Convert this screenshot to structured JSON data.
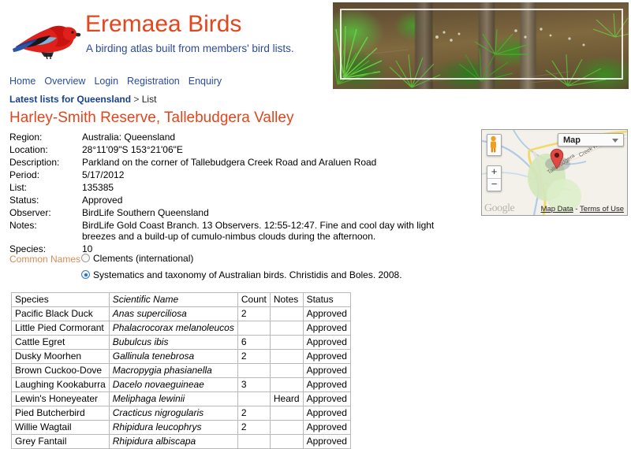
{
  "site": {
    "title": "Eremaea Birds",
    "tagline": "A birding atlas built from members' bird lists.",
    "logo_alt": "crimson-rosella-logo",
    "banner_alt": "rainforest-palm-understorey-photo"
  },
  "nav": {
    "items": [
      {
        "label": "Home"
      },
      {
        "label": "Overview"
      },
      {
        "label": "Login"
      },
      {
        "label": "Registration"
      },
      {
        "label": "Enquiry"
      }
    ]
  },
  "breadcrumb": {
    "parent": "Latest lists for Queensland",
    "separator": ">",
    "current": "List"
  },
  "page": {
    "title": "Harley-Smith Reserve, Tallebudgera Valley"
  },
  "details": {
    "rows": [
      {
        "key": "Region:",
        "value": "Australia: Queensland"
      },
      {
        "key": "Location:",
        "value": "28°11'09\"S 153°21'06\"E"
      },
      {
        "key": "Description:",
        "value": "Parkland on the corner of Tallebudgera Creek Road and Araluen Road"
      },
      {
        "key": "Period:",
        "value": "5/17/2012"
      },
      {
        "key": "List:",
        "value": "135385"
      },
      {
        "key": "Status:",
        "value": "Approved"
      },
      {
        "key": "Observer:",
        "value": "BirdLife Southern Queensland"
      },
      {
        "key": "Notes:",
        "value": "BirdLife Gold Coast Branch. 13 Observers. 12:55-12:47. Fine and cool day with light breezes and a build-up of cumulo-nimbus clouds during the afternoon."
      },
      {
        "key": "Species:",
        "value": "10"
      }
    ]
  },
  "map": {
    "type_button": "Map",
    "zoom_in": "+",
    "zoom_out": "−",
    "road_label": "Tallebudgera",
    "road_label2": "Creek Rd",
    "watermark": "Google",
    "map_data_link": "Map Data",
    "attrib_separator": "-",
    "terms_link": "Terms of Use"
  },
  "common_names": {
    "label": "Common Names",
    "options": [
      {
        "label": "Clements (international)",
        "selected": false
      },
      {
        "label": "Systematics and taxonomy of Australian birds. Christidis and Boles. 2008.",
        "selected": true
      }
    ]
  },
  "species_table": {
    "columns": [
      "Species",
      "Scientific Name",
      "Count",
      "Notes",
      "Status"
    ],
    "rows": [
      {
        "species": "Pacific Black Duck",
        "scientific": "Anas superciliosa",
        "count": "2",
        "notes": "",
        "status": "Approved"
      },
      {
        "species": "Little Pied Cormorant",
        "scientific": "Phalacrocorax melanoleucos",
        "count": "",
        "notes": "",
        "status": "Approved"
      },
      {
        "species": "Cattle Egret",
        "scientific": "Bubulcus ibis",
        "count": "6",
        "notes": "",
        "status": "Approved"
      },
      {
        "species": "Dusky Moorhen",
        "scientific": "Gallinula tenebrosa",
        "count": "2",
        "notes": "",
        "status": "Approved"
      },
      {
        "species": "Brown Cuckoo-Dove",
        "scientific": "Macropygia phasianella",
        "count": "",
        "notes": "",
        "status": "Approved"
      },
      {
        "species": "Laughing Kookaburra",
        "scientific": "Dacelo novaeguineae",
        "count": "3",
        "notes": "",
        "status": "Approved"
      },
      {
        "species": "Lewin's Honeyeater",
        "scientific": "Meliphaga lewinii",
        "count": "",
        "notes": "Heard",
        "status": "Approved"
      },
      {
        "species": "Pied Butcherbird",
        "scientific": "Cracticus nigrogularis",
        "count": "2",
        "notes": "",
        "status": "Approved"
      },
      {
        "species": "Willie Wagtail",
        "scientific": "Rhipidura leucophrys",
        "count": "2",
        "notes": "",
        "status": "Approved"
      },
      {
        "species": "Grey Fantail",
        "scientific": "Rhipidura albiscapa",
        "count": "",
        "notes": "",
        "status": "Approved"
      }
    ]
  },
  "colors": {
    "brand_orange": "#e2461c",
    "link_blue": "#2b4b9b",
    "breadcrumb_blue": "#17418e",
    "common_names_label": "#d98a54",
    "marker_red": "#e04a42"
  }
}
